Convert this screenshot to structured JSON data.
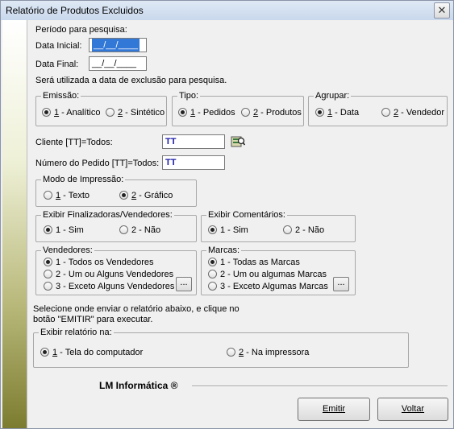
{
  "window": {
    "title": "Relatório de Produtos Excluidos",
    "close_glyph": "✕"
  },
  "periodo": {
    "label": "Período para pesquisa:",
    "data_inicial_label": "Data Inicial:",
    "data_inicial_value": "__/__/____",
    "data_final_label": "Data Final:",
    "data_final_value": "__/__/____",
    "note": "Será utilizada a data de exclusão para pesquisa."
  },
  "emissao": {
    "legend": "Emissão:",
    "opt1_num": "1",
    "opt1_text": " - Analítico",
    "opt2_num": "2",
    "opt2_text": " - Sintético",
    "selected": 1
  },
  "tipo": {
    "legend": "Tipo:",
    "opt1_num": "1",
    "opt1_text": " - Pedidos",
    "opt2_num": "2",
    "opt2_text": " - Produtos",
    "selected": 1
  },
  "agrupar": {
    "legend": "Agrupar:",
    "opt1_num": "1",
    "opt1_text": " - Data",
    "opt2_num": "2",
    "opt2_text": " - Vendedor",
    "selected": 1
  },
  "cliente": {
    "label": "Cliente [TT]=Todos:",
    "value": "TT"
  },
  "pedido": {
    "label": "Número do Pedido [TT]=Todos:",
    "value": "TT"
  },
  "modo": {
    "legend": "Modo de Impressão:",
    "opt1_num": "1",
    "opt1_text": " - Texto",
    "opt2_num": "2",
    "opt2_text": " - Gráfico",
    "selected": 2
  },
  "finalizadoras": {
    "legend": "Exibir Finalizadoras/Vendedores:",
    "opt1": "1 - Sim",
    "opt2": "2 - Não",
    "selected": 1
  },
  "comentarios": {
    "legend": "Exibir Comentários:",
    "opt1": "1 - Sim",
    "opt2": "2 - Não",
    "selected": 1
  },
  "vendedores": {
    "legend": "Vendedores:",
    "opt1": "1 - Todos os Vendedores",
    "opt2": "2 - Um ou Alguns Vendedores",
    "opt3": "3 - Exceto Alguns Vendedores",
    "selected": 1,
    "more": "..."
  },
  "marcas": {
    "legend": "Marcas:",
    "opt1": "1 - Todas as Marcas",
    "opt2": "2 - Um ou algumas Marcas",
    "opt3": "3 - Exceto Algumas Marcas",
    "selected": 1,
    "more": "..."
  },
  "instrucao": {
    "line1": "Selecione onde enviar o relatório abaixo, e clique no",
    "line2": "botão \"EMITIR\" para executar."
  },
  "exibir": {
    "legend": "Exibir relatório na:",
    "opt1_num": "1",
    "opt1_text": " - Tela do computador",
    "opt2_num": "2",
    "opt2_text": " - Na impressora",
    "selected": 1
  },
  "footer": {
    "brand": "LM Informática ®"
  },
  "buttons": {
    "emitir": "Emitir",
    "voltar": "Voltar"
  }
}
